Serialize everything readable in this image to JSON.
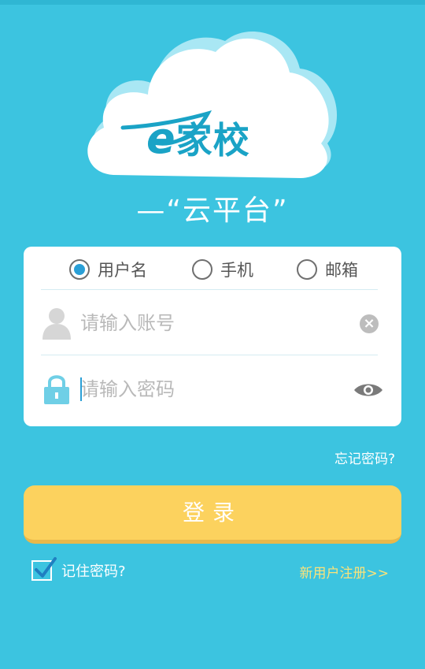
{
  "brand": {
    "logo_letter": "e",
    "name": "家校",
    "slogan": "—“云平台”"
  },
  "login_type": {
    "options": [
      {
        "label": "用户名",
        "checked": true
      },
      {
        "label": "手机",
        "checked": false
      },
      {
        "label": "邮箱",
        "checked": false
      }
    ]
  },
  "account": {
    "placeholder": "请输入账号",
    "value": ""
  },
  "password": {
    "placeholder": "请输入密码",
    "value": ""
  },
  "forgot_password": "忘记密码?",
  "login_button": "登录",
  "remember_password": {
    "label": "记住密码?",
    "checked": true
  },
  "register_link": "新用户注册>>",
  "icons": [
    "user-icon",
    "lock-icon",
    "clear-icon",
    "eye-icon",
    "check-icon"
  ],
  "colors": {
    "background": "#3cc4e0",
    "brand_blue": "#1aa3c6",
    "login_button": "#fcd25e",
    "radio_selected": "#2a9fd6",
    "register_link": "#fbe37a"
  }
}
